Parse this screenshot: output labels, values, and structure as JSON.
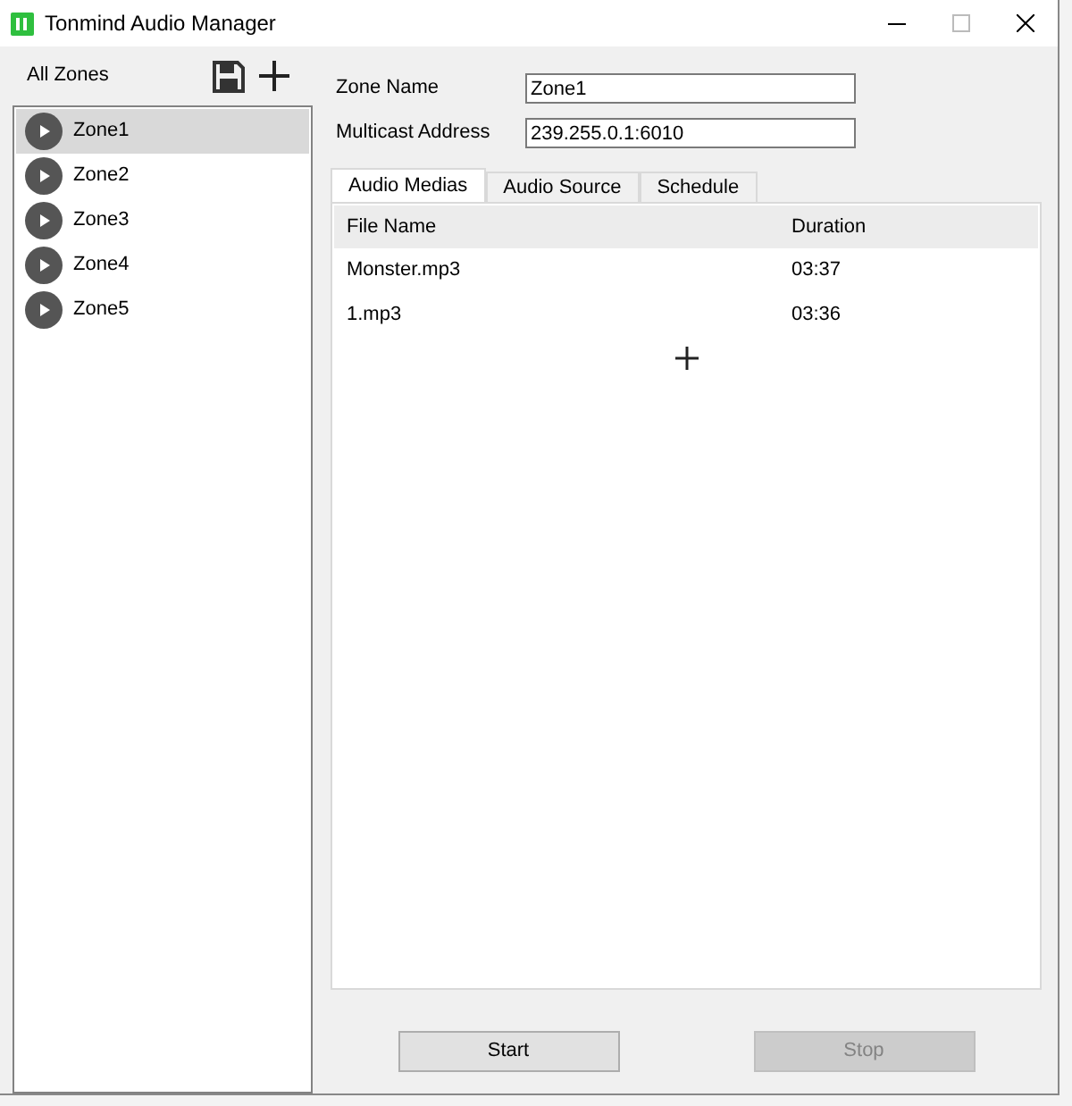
{
  "window": {
    "title": "Tonmind Audio Manager"
  },
  "sidebar": {
    "title": "All Zones",
    "items": [
      {
        "label": "Zone1",
        "selected": true
      },
      {
        "label": "Zone2",
        "selected": false
      },
      {
        "label": "Zone3",
        "selected": false
      },
      {
        "label": "Zone4",
        "selected": false
      },
      {
        "label": "Zone5",
        "selected": false
      }
    ]
  },
  "fields": [
    {
      "label": "Zone Name",
      "value": "Zone1"
    },
    {
      "label": "Multicast Address",
      "value": "239.255.0.1:6010"
    }
  ],
  "tabs": [
    {
      "label": "Audio Medias",
      "selected": true
    },
    {
      "label": "Audio Source",
      "selected": false
    },
    {
      "label": "Schedule",
      "selected": false
    }
  ],
  "table": {
    "columns": [
      "File Name",
      "Duration"
    ],
    "rows": [
      [
        "Monster.mp3",
        "03:37"
      ],
      [
        "1.mp3",
        "03:36"
      ]
    ]
  },
  "buttons": [
    {
      "label": "Start",
      "disabled": false
    },
    {
      "label": "Stop",
      "disabled": true
    }
  ]
}
